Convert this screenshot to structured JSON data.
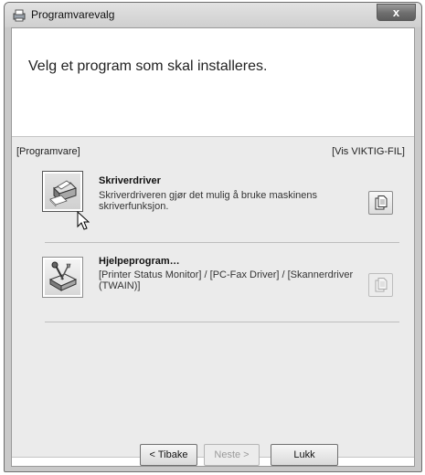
{
  "window": {
    "title": "Programvarevalg",
    "close_label": "x"
  },
  "heading": "Velg et program som skal installeres.",
  "section": {
    "label": "[Programvare]",
    "readme_link": "[Vis VIKTIG-FIL]"
  },
  "items": [
    {
      "title": "Skriverdriver",
      "description": "Skriverdriveren gjør det mulig å bruke maskinens skriverfunksjon.",
      "icon": "printer-driver-icon",
      "readme_enabled": true
    },
    {
      "title": "Hjelpeprogram…",
      "description": "[Printer Status Monitor] / [PC-Fax Driver] / [Skannerdriver (TWAIN)]",
      "icon": "utility-icon",
      "readme_enabled": false
    }
  ],
  "buttons": {
    "back": "< Tibake",
    "next": "Neste >",
    "close": "Lukk"
  }
}
